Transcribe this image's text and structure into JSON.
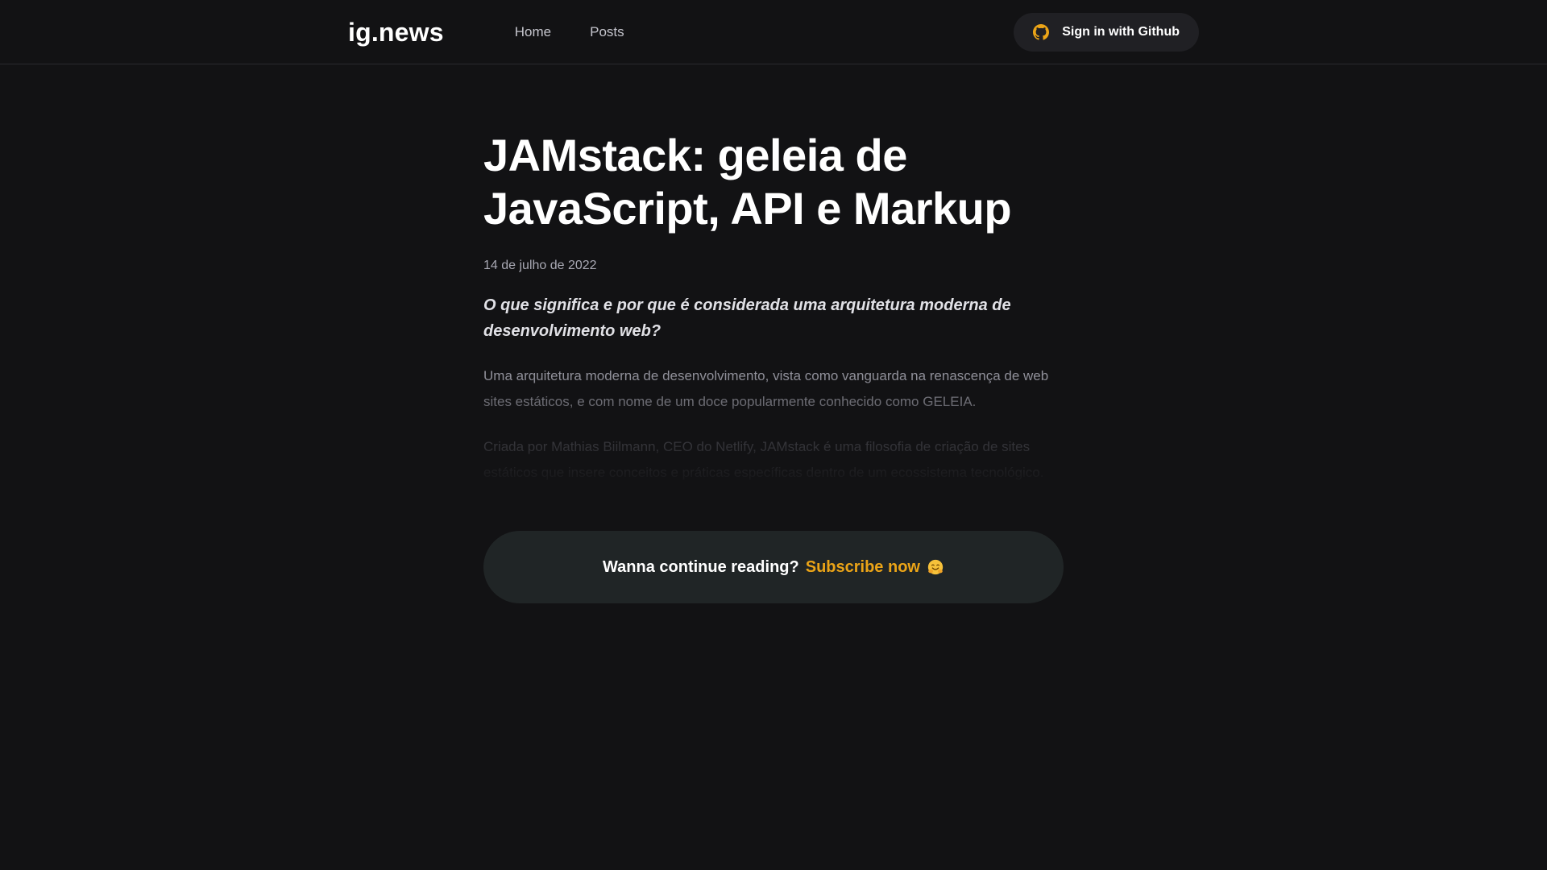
{
  "header": {
    "logo": "ig.news",
    "nav": [
      {
        "label": "Home"
      },
      {
        "label": "Posts"
      }
    ],
    "signin_label": "Sign in with Github",
    "github_icon": "github-icon",
    "accent_color": "#eba417"
  },
  "post": {
    "title": "JAMstack: geleia de JavaScript, API e Markup",
    "date": "14 de julho de 2022",
    "lead": "O que significa e por que é considerada uma arquitetura moderna de desenvolvimento web?",
    "paragraphs": [
      "Uma arquitetura moderna de desenvolvimento, vista como vanguarda na renascença de web sites estáticos, e com nome de um doce popularmente conhecido como GELEIA.",
      "Criada por Mathias Biilmann, CEO do Netlify, JAMstack é uma filosofia de criação de sites estáticos que insere conceitos e práticas específicas dentro de um ecossistema tecnológico."
    ]
  },
  "continue_reading": {
    "text": "Wanna continue reading?",
    "link_label": "Subscribe now",
    "emoji_icon": "hugging-face-emoji-icon"
  }
}
